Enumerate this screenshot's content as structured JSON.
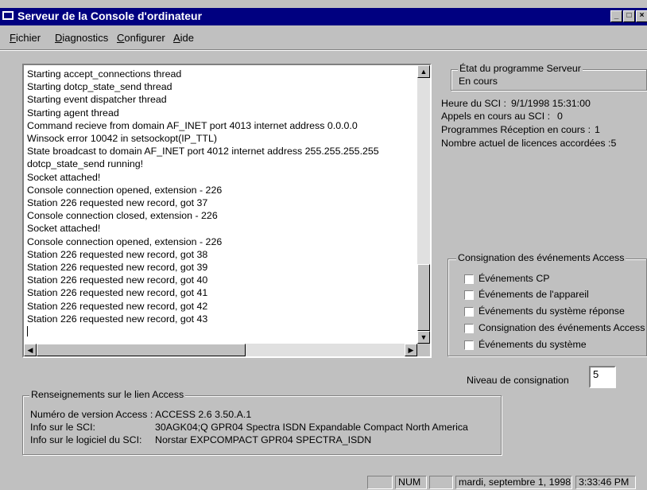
{
  "window": {
    "title": "Serveur de la Console d'ordinateur"
  },
  "menu": [
    {
      "label": "Fichier"
    },
    {
      "label": "Diagnostics"
    },
    {
      "label": "Configurer"
    },
    {
      "label": "Aide"
    }
  ],
  "log": {
    "lines": [
      "Starting accept_connections thread",
      "Starting dotcp_state_send thread",
      "Starting event dispatcher thread",
      "Starting agent thread",
      "Command recieve from domain AF_INET port 4013 internet address 0.0.0.0",
      "Winsock error 10042 in setsockopt(IP_TTL)",
      "State broadcast to domain AF_INET port 4012 internet address 255.255.255.255",
      "dotcp_state_send running!",
      "Socket attached!",
      "Console connection opened, extension - 226",
      "Station 226 requested new record, got 37",
      "Console connection closed, extension - 226",
      "Socket attached!",
      "Console connection opened, extension - 226",
      "Station 226 requested new record, got 38",
      "Station 226 requested new record, got 39",
      "Station 226 requested new record, got 40",
      "Station 226 requested new record, got 41",
      "Station 226 requested new record, got 42",
      "Station 226 requested new record, got 43"
    ]
  },
  "server_state": {
    "label": "État du programme Serveur",
    "value": "En cours"
  },
  "info": {
    "heure_label": "Heure du SCI :",
    "heure_value": "9/1/1998 15:31:00",
    "appels_label": "Appels en cours au SCI :",
    "appels_value": "0",
    "programmes_label": "Programmes Réception en cours :",
    "programmes_value": "1",
    "licences_label": "Nombre actuel de licences accordées :5"
  },
  "logging": {
    "label": "Consignation des événements Access",
    "options": [
      {
        "label": "Événements CP",
        "checked": false
      },
      {
        "label": "Événements de l'appareil",
        "checked": false
      },
      {
        "label": "Événements du système  réponse",
        "checked": false
      },
      {
        "label": "Consignation des événements Access",
        "checked": false
      },
      {
        "label": "Événements du système",
        "checked": false
      }
    ],
    "level_label": "Niveau de consignation",
    "level_value": "5"
  },
  "access_link": {
    "label": "Renseignements sur le lien Access",
    "version_label": "Numéro de version Access :",
    "version_value": "ACCESS 2.6 3.50.A.1",
    "sci_label": "Info sur le  SCI:",
    "sci_value": "30AGK04;Q GPR04 Spectra ISDN Expandable Compact North America",
    "software_label": "Info sur le logiciel du SCI:",
    "software_value": "Norstar EXPCOMPACT GPR04 SPECTRA_ISDN"
  },
  "status": {
    "num": "NUM",
    "date": "mardi, septembre 1, 1998",
    "time": "3:33:46 PM"
  }
}
